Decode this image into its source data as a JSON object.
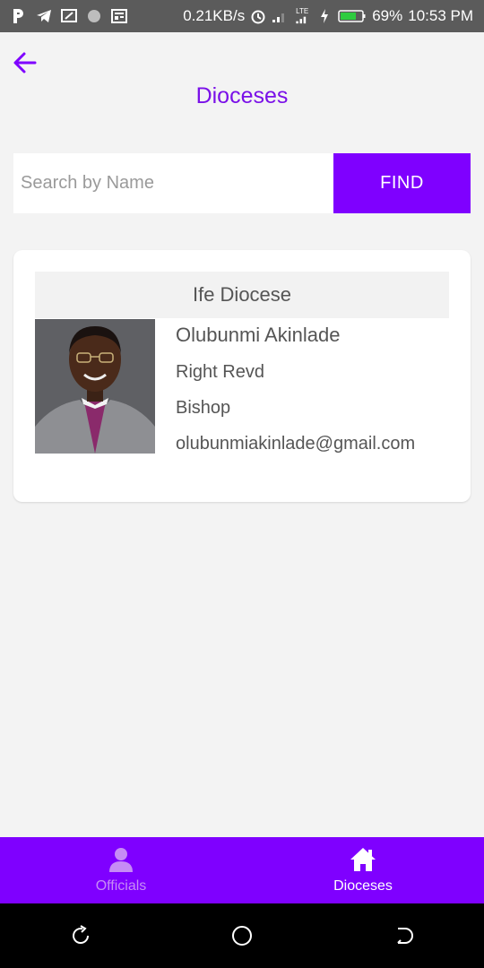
{
  "status_bar": {
    "speed": "0.21KB/s",
    "battery": "69%",
    "time": "10:53 PM",
    "network_label": "LTE"
  },
  "header": {
    "title": "Dioceses"
  },
  "search": {
    "placeholder": "Search by Name",
    "value": "",
    "button_label": "FIND"
  },
  "card": {
    "diocese": "Ife Diocese",
    "name": "Olubunmi Akinlade",
    "title": "Right Revd",
    "role": "Bishop",
    "email": "olubunmiakinlade@gmail.com"
  },
  "bottom_nav": {
    "items": [
      {
        "label": "Officials",
        "icon": "person-icon",
        "active": false
      },
      {
        "label": "Dioceses",
        "icon": "home-icon",
        "active": true
      }
    ]
  },
  "colors": {
    "accent": "#7f00ff",
    "title": "#7a10e8",
    "status_bar": "#5b5b5b",
    "background": "#f3f3f3"
  }
}
